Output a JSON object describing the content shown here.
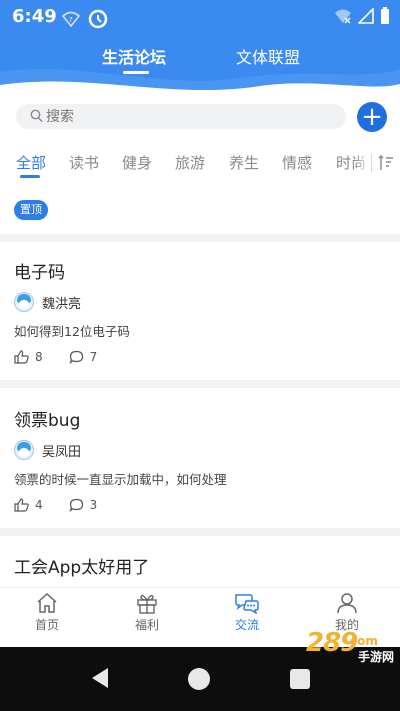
{
  "status_bar": {
    "time": "6:49"
  },
  "header_tabs": [
    {
      "label": "生活论坛",
      "active": true
    },
    {
      "label": "文体联盟",
      "active": false
    }
  ],
  "search": {
    "placeholder": "搜索"
  },
  "categories": [
    {
      "label": "全部",
      "active": true
    },
    {
      "label": "读书"
    },
    {
      "label": "健身"
    },
    {
      "label": "旅游"
    },
    {
      "label": "养生"
    },
    {
      "label": "情感"
    },
    {
      "label": "时尚"
    }
  ],
  "pin_badge": "置顶",
  "posts": [
    {
      "title": "电子码",
      "author": "魏洪亮",
      "desc": "如何得到12位电子码",
      "likes": "8",
      "comments": "7"
    },
    {
      "title": "领票bug",
      "author": "吴凤田",
      "desc": "领票的时候一直显示加载中，如何处理",
      "likes": "4",
      "comments": "3"
    },
    {
      "title": "工会App太好用了"
    }
  ],
  "tabbar": [
    {
      "label": "首页",
      "icon": "home-icon"
    },
    {
      "label": "福利",
      "icon": "gift-icon"
    },
    {
      "label": "交流",
      "icon": "chat-icon",
      "active": true
    },
    {
      "label": "我的",
      "icon": "user-icon"
    }
  ],
  "watermark": {
    "number": "289",
    "suffix": "com",
    "text": "手游网"
  },
  "colors": {
    "header": "#3b8af0",
    "accent": "#2f7de8",
    "add_button": "#1f6fe0"
  }
}
